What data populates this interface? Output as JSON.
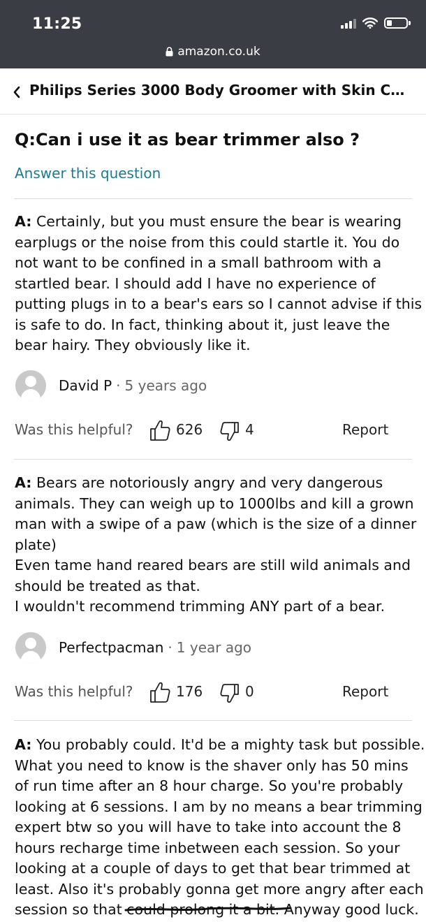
{
  "status_bar": {
    "time": "11:25",
    "icons": [
      "cellular-signal-icon",
      "wifi-icon",
      "battery-icon"
    ]
  },
  "browser": {
    "url": "amazon.co.uk",
    "lock_icon": "lock-icon"
  },
  "header": {
    "back_icon": "chevron-left-icon",
    "product_title": "Philips Series 3000 Body Groomer with Skin Comf..."
  },
  "question": {
    "text": "Q:Can i use it as bear trimmer also ?",
    "answer_link": "Answer this question"
  },
  "colors": {
    "link": "#1d7a8a",
    "chrome": "#3a3d43",
    "divider": "#dcdcdc"
  },
  "answers": [
    {
      "label": "A:",
      "lines": [
        " Certainly, but you must ensure the bear is wearing",
        "earplugs or the noise from this could startle it. You do",
        "not want to be confined in a small bathroom with a",
        "startled bear. I should add I have no experience of",
        "putting plugs in to a bear's ears so I cannot advise if this",
        "is safe to do. In fact, thinking about it, just leave the",
        "bear hairy. They obviously like it."
      ],
      "author": "David P",
      "separator": "·",
      "time": "5 years ago",
      "helpful_label": "Was this helpful?",
      "upvotes": "626",
      "downvotes": "4",
      "report": "Report"
    },
    {
      "label": "A:",
      "lines": [
        " Bears are notoriously angry and very dangerous",
        "animals. They can weigh up to 1000lbs and kill a grown",
        "man with a swipe of a paw (which is the size of a dinner",
        "plate)",
        "Even tame hand reared bears are still wild animals and",
        "should be treated as that.",
        "I wouldn't recommend trimming ANY part of a bear."
      ],
      "author": "Perfectpacman",
      "separator": "·",
      "time": "1 year ago",
      "helpful_label": "Was this helpful?",
      "upvotes": "176",
      "downvotes": "0",
      "report": "Report"
    },
    {
      "label": "A:",
      "lines": [
        " You probably could. It'd be a mighty task but possible.",
        "What you need to know is the shaver only has 50 mins",
        "of run time after an 8 hour charge. So you're probably",
        "looking at 6 sessions. I am by no means a bear trimming",
        "expert btw so you will have to take into account the 8",
        "hours recharge time inbetween each session. So your",
        "looking at a couple of days to get that bear trimmed at",
        "least. Also it's probably gonna get more angry after each",
        "session so that could prolong it a bit. Anyway good luck."
      ]
    }
  ]
}
